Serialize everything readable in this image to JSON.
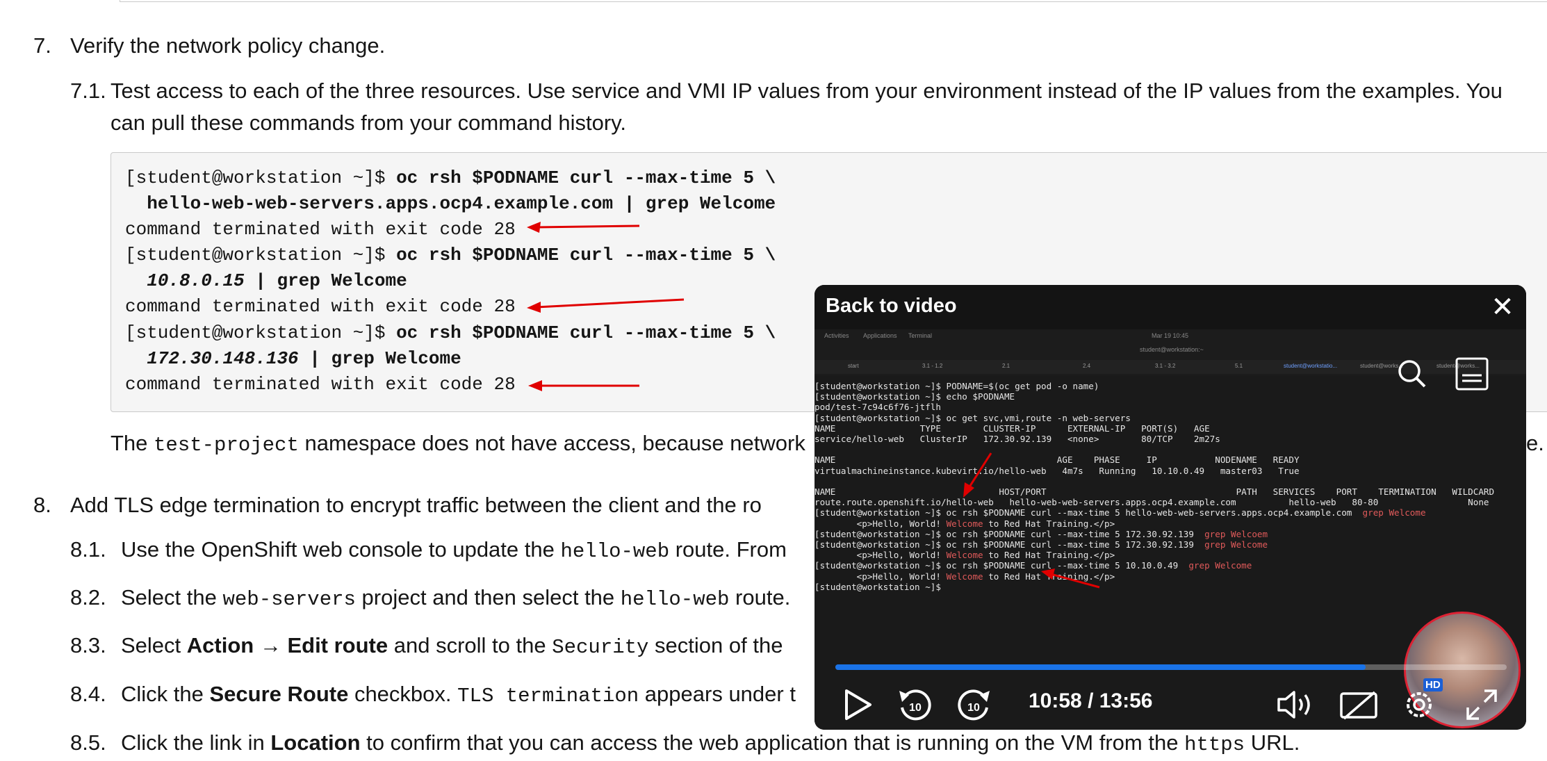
{
  "steps": {
    "s7": {
      "num": "7.",
      "text": "Verify the network policy change."
    },
    "s71": {
      "num": "7.1.",
      "line1": "Test access to each of the three resources. Use service and VMI IP values from your environment instead of the IP values from the examples. You",
      "line2": "can pull these commands from your command history."
    },
    "after_code": {
      "pre": "The ",
      "code": "test-project",
      "post": " namespace does not have access, because network",
      "tail": "e."
    },
    "s8": {
      "num": "8.",
      "text": "Add TLS edge termination to encrypt traffic between the client and the ro"
    },
    "s81": {
      "num": "8.1.",
      "pre": "Use the OpenShift web console to update the ",
      "code": "hello-web",
      "post": " route. From"
    },
    "s82": {
      "num": "8.2.",
      "pre": "Select the ",
      "code1": "web-servers",
      "mid": " project and then select the ",
      "code2": "hello-web",
      "post": " route."
    },
    "s83": {
      "num": "8.3.",
      "pre": "Select ",
      "b1": "Action",
      "arrow": " → ",
      "b2": "Edit route",
      "mid": " and scroll to the ",
      "code": "Security",
      "post": " section of the "
    },
    "s84": {
      "num": "8.4.",
      "pre": "Click the ",
      "b1": "Secure Route",
      "mid": " checkbox. ",
      "code": "TLS termination",
      "post": " appears under t"
    },
    "s85": {
      "num": "8.5.",
      "pre": "Click the link in ",
      "b1": "Location",
      "mid": " to confirm that you can access the web application that is running on the VM from the ",
      "code": "https",
      "post": " URL."
    }
  },
  "code_block": {
    "prompt": "[student@workstation ~]$ ",
    "cmd1a": "oc rsh $PODNAME curl --max-time 5 \\",
    "cmd1b": "  hello-web-web-servers.apps.ocp4.example.com | grep Welcome",
    "out1": "command terminated with exit code 28",
    "cmd2a": "oc rsh $PODNAME curl --max-time 5 \\",
    "cmd2b_ip": "10.8.0.15",
    "cmd2b_rest": " | grep Welcome",
    "out2": "command terminated with exit code 28",
    "cmd3a": "oc rsh $PODNAME curl --max-time 5 \\",
    "cmd3b_ip": "172.30.148.136",
    "cmd3b_rest": " | grep Welcome",
    "out3": "command terminated with exit code 28"
  },
  "video_overlay": {
    "title": "Back to video",
    "close_label": "✕",
    "time": "10:58 / 13:56",
    "progress": 0.79,
    "hd_badge": "HD",
    "rewind_label": "10",
    "forward_label": "10",
    "topbar": {
      "activities": "Activities",
      "applications": "Applications",
      "terminal": "Terminal",
      "clock": "Mar 19 10:45",
      "window_title": "student@workstation:~"
    },
    "tabs": [
      "start",
      "3.1 - 1.2",
      "2.1",
      "2.4",
      "3.1 - 3.2",
      "5.1",
      "student@workstatio...",
      "student@works...",
      "student@works..."
    ],
    "terminal_lines": [
      "[student@workstation ~]$ PODNAME=$(oc get pod -o name)",
      "[student@workstation ~]$ echo $PODNAME",
      "pod/test-7c94c6f76-jtflh",
      "[student@workstation ~]$ oc get svc,vmi,route -n web-servers",
      "NAME                TYPE        CLUSTER-IP      EXTERNAL-IP   PORT(S)   AGE",
      "service/hello-web   ClusterIP   172.30.92.139   <none>        80/TCP    2m27s",
      "",
      "NAME                                          AGE    PHASE     IP           NODENAME   READY",
      "virtualmachineinstance.kubevirt.io/hello-web   4m7s   Running   10.10.0.49   master03   True",
      "",
      "NAME                               HOST/PORT                                    PATH   SERVICES    PORT    TERMINATION   WILDCARD",
      "route.route.openshift.io/hello-web   hello-web-web-servers.apps.ocp4.example.com          hello-web   80-80                 None",
      "[student@workstation ~]$ oc rsh $PODNAME curl --max-time 5 hello-web-web-servers.apps.ocp4.example.com | grep Welcome",
      "        <p>Hello, World! |Welcome| to Red Hat Training.</p>",
      "[student@workstation ~]$ oc rsh $PODNAME curl --max-time 5 172.30.92.139 | grep Welcoem",
      "[student@workstation ~]$ oc rsh $PODNAME curl --max-time 5 172.30.92.139 | grep Welcome",
      "        <p>Hello, World! |Welcome| to Red Hat Training.</p>",
      "[student@workstation ~]$ oc rsh $PODNAME curl --max-time 5 10.10.0.49 | grep Welcome",
      "        <p>Hello, World! |Welcome| to Red Hat Training.</p>",
      "[student@workstation ~]$"
    ]
  },
  "colors": {
    "accent": "#1a73e8",
    "arrow": "#e00000",
    "welcome": "#e05a5a"
  }
}
